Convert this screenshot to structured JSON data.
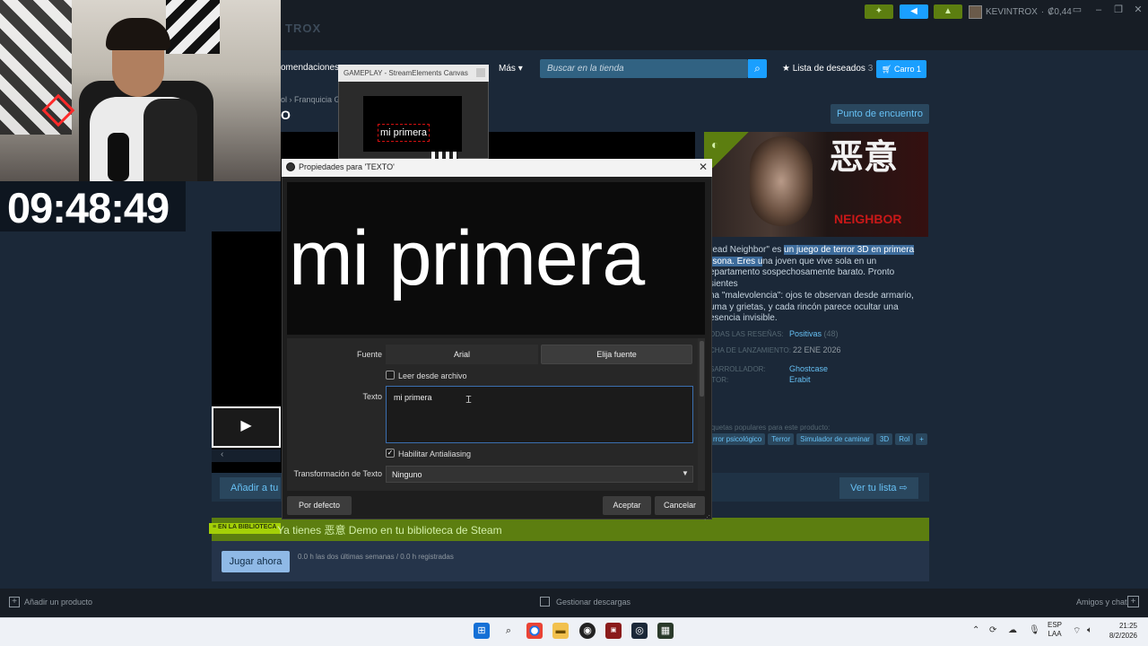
{
  "steam": {
    "top": {
      "account_name": "KEVINTROX",
      "balance": "₡0,44",
      "title_partial": "TROX"
    },
    "nav": {
      "recommendations_partial": "omendaciones",
      "more": "Más",
      "search_placeholder": "Buscar en la tienda",
      "wishlist": "Lista de deseados",
      "wishlist_count": "3",
      "cart": "Carro",
      "cart_count": "1"
    },
    "breadcrumb": "ol  ›  Franquicia Gl",
    "game_title_partial": "O",
    "community_hub_button": "Punto de encuentro",
    "capsule_logo": "恶意",
    "capsule_logo_sub": "NEIGHBOR",
    "description": {
      "p1": "read Neighbor\" es ",
      "p1_hl": "un juego de terror 3D en primera",
      "p2_hl": "rsona. Eres u",
      "p2": "na joven que vive sola en un",
      "p3": "epartamento sospechosamente barato. Pronto sientes",
      "p4": "na \"malevolencia\": ojos te observan desde armario,",
      "p5": "uma y grietas, y cada rincón parece ocultar una",
      "p6": "esencia invisible."
    },
    "meta": {
      "reviews_label": "odas las reseñas:",
      "reviews_value": "Positivas",
      "reviews_count": "(48)",
      "release_label": "cha de lanzamiento:",
      "release_value": "22 ENE 2026",
      "developer_label": "sarrollador:",
      "developer_value": "Ghostcase",
      "publisher_label": "itor:",
      "publisher_value": "Erabit"
    },
    "tags_label": "iquetas populares para este producto:",
    "tags": [
      "rror psicológico",
      "Terror",
      "Simulador de caminar",
      "3D",
      "Rol",
      "+"
    ],
    "add_wishlist_partial": "Añadir a tu lis",
    "view_list": "Ver tu lista",
    "library": {
      "badge": "EN LA BIBLIOTECA",
      "message": "Ya tienes 恶意 Demo en tu biblioteca de Steam",
      "play_button": "Jugar ahora",
      "stats": "0.0 h las dos últimas semanas / 0.0 h registradas"
    },
    "bottom": {
      "add_product": "Añadir un producto",
      "downloads": "Gestionar descargas",
      "friends": "Amigos y chat"
    }
  },
  "webcam": {
    "clock": "09:48:49"
  },
  "obs_preview": {
    "title": "GAMEPLAY - StreamElements Canvas",
    "text": "mi primera"
  },
  "dialog": {
    "title": "Propiedades para 'TEXTO'",
    "preview_text": "mi primera",
    "font_label": "Fuente",
    "font_name": "Arial",
    "choose_font": "Elija fuente",
    "read_from_file": "Leer desde archivo",
    "read_from_file_checked": false,
    "text_label": "Texto",
    "text_value": "mi primera",
    "antialiasing": "Habilitar Antialiasing",
    "antialiasing_checked": true,
    "transform_label": "Transformación de Texto",
    "transform_value": "Ninguno",
    "default_button": "Por defecto",
    "ok_button": "Aceptar",
    "cancel_button": "Cancelar"
  },
  "taskbar": {
    "language_top": "ESP",
    "language_bottom": "LAA",
    "time": "21:25",
    "date": "8/2/2026"
  },
  "colors": {
    "steam_bg": "#1b2838",
    "steam_accent": "#1a9fff",
    "library_green": "#5c7e10",
    "dialog_bg": "#1e1e1e"
  }
}
